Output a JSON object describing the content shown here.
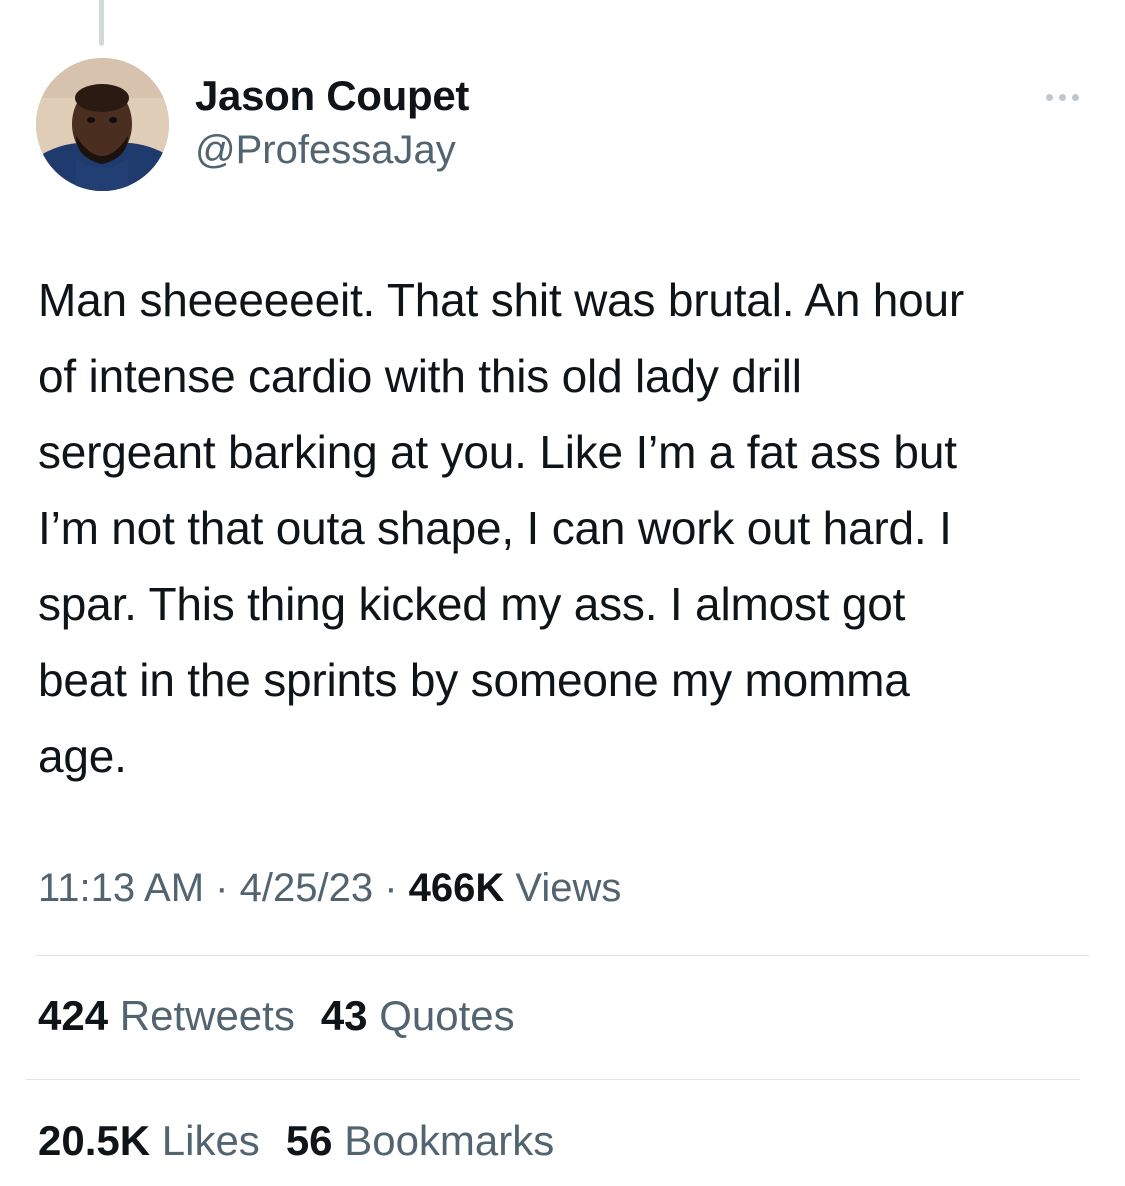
{
  "tweet": {
    "author": {
      "name": "Jason Coupet",
      "handle": "@ProfessaJay",
      "avatar": "profile-photo"
    },
    "text": "Man sheeeeeeit. That shit was brutal. An hour\nof intense cardio with this old lady drill\nsergeant barking at you. Like I’m a fat ass but\nI’m not that outa shape, I can work out hard. I\nspar. This thing kicked my ass. I almost got\nbeat in the sprints by someone my momma\nage.",
    "time": "11:13 AM",
    "date": "4/25/23",
    "separator": "·",
    "views": {
      "count": "466K",
      "label": "Views"
    },
    "retweets": {
      "count": "424",
      "label": "Retweets"
    },
    "quotes": {
      "count": "43",
      "label": "Quotes"
    },
    "likes": {
      "count": "20.5K",
      "label": "Likes"
    },
    "bookmarks": {
      "count": "56",
      "label": "Bookmarks"
    },
    "more_icon": "ellipsis-icon"
  },
  "colors": {
    "primary_text": "#0f1419",
    "secondary_text": "#536471",
    "divider": "#dfe5e9",
    "thread_line": "#cfd9de"
  }
}
